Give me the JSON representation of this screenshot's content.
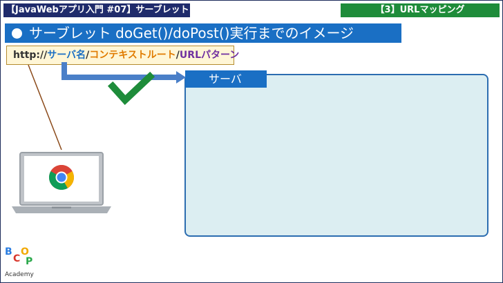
{
  "header": {
    "series_label": "【JavaWebアプリ入門 #07】サーブレット",
    "section_label": "【3】URLマッピング"
  },
  "title": "サーブレット doGet()/doPost()実行までのイメージ",
  "url": {
    "protocol": "http://",
    "server": "サーバ名",
    "sep1": "/",
    "context": "コンテキストルート",
    "sep2": "/",
    "pattern": "URLパターン"
  },
  "server_label": "サーバ",
  "logo": {
    "letters": [
      "B",
      "C",
      "O",
      "P"
    ],
    "text": "Academy"
  },
  "colors": {
    "series_bg": "#1f2b6b",
    "section_bg": "#1e8c3a",
    "title_bg": "#1a6fc4",
    "server_bg": "#dceef2",
    "checkmark": "#1e8c3a"
  },
  "icons": {
    "browser": "chrome-icon",
    "device": "laptop-icon",
    "mark": "checkmark-icon"
  }
}
